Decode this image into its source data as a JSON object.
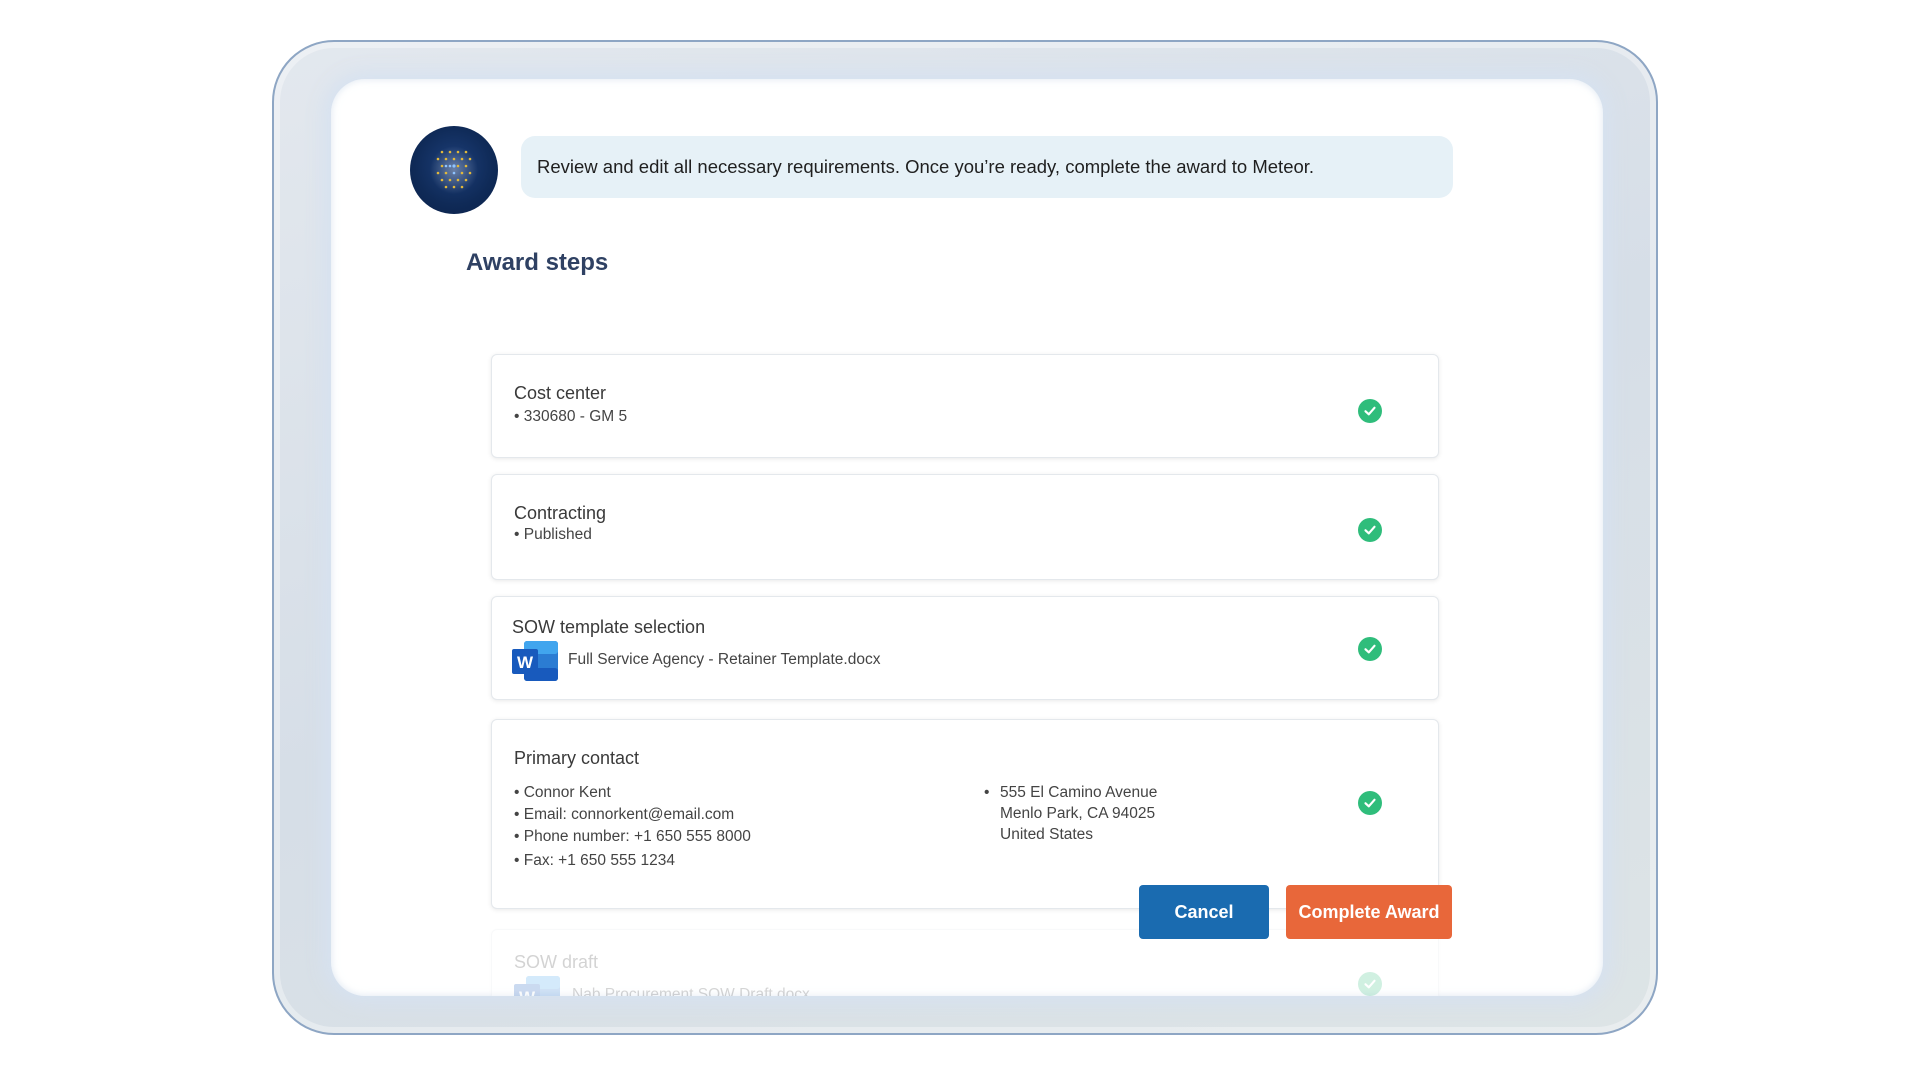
{
  "assistant": {
    "message": "Review and edit all necessary requirements. Once you’re ready, complete the award to Meteor."
  },
  "page": {
    "heading": "Award steps"
  },
  "steps": [
    {
      "title": "Cost center",
      "lines": [
        "• 330680 - GM 5"
      ],
      "status": "complete"
    },
    {
      "title": "Contracting",
      "lines": [
        "• Published"
      ],
      "status": "complete"
    },
    {
      "title": "SOW template selection",
      "file": "Full Service Agency - Retainer Template.docx",
      "status": "complete"
    },
    {
      "title": "Primary contact",
      "contact": [
        "• Connor Kent",
        "• Email: connorkent@email.com",
        "• Phone number: +1 650 555 8000",
        "• Fax: +1 650 555 1234"
      ],
      "address": [
        "555 El Camino Avenue",
        "Menlo Park, CA 94025",
        "United States"
      ],
      "status": "complete"
    },
    {
      "title": "SOW draft",
      "file": "Nab Procurement SOW Draft.docx",
      "status": "complete"
    }
  ],
  "icons": {
    "word": "W"
  },
  "actions": {
    "cancel": "Cancel",
    "complete": "Complete Award"
  },
  "colors": {
    "heading": "#2f4163",
    "bubble": "#e6f1f7",
    "check": "#2fbd7b",
    "cancel_button": "#1a6bb0",
    "complete_button": "#e8673a"
  }
}
